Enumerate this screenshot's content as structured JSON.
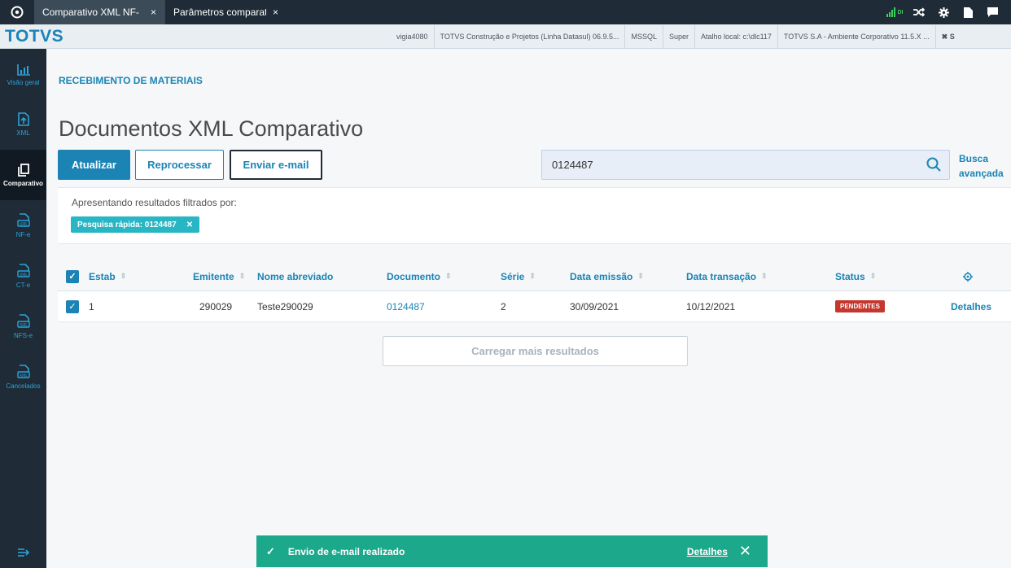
{
  "topbar": {
    "tabs": [
      {
        "title": "Comparativo XML NF-",
        "close": "×"
      },
      {
        "title": "Parâmetros comparati",
        "close": "×"
      }
    ],
    "signal_label": "DI"
  },
  "header": {
    "brand": "TOTVS",
    "info": [
      "vigia4080",
      "TOTVS Construção e Projetos (Linha Datasul) 06.9.5...",
      "MSSQL",
      "Super",
      "Atalho local: c:\\dlc117",
      "TOTVS S.A - Ambiente Corporativo 11.5.X ...",
      "✖ S"
    ]
  },
  "sidebar": {
    "items": [
      {
        "label": "Visão geral",
        "icon": "chart-icon"
      },
      {
        "label": "XML",
        "icon": "upload-file-icon"
      },
      {
        "label": "Comparativo",
        "icon": "copy-icon"
      },
      {
        "label": "NF-e",
        "icon": "xml-file-icon"
      },
      {
        "label": "CT-e",
        "icon": "xml-file-icon"
      },
      {
        "label": "NFS-e",
        "icon": "xml-file-icon"
      },
      {
        "label": "Cancelados",
        "icon": "xml-file-icon"
      }
    ]
  },
  "page": {
    "breadcrumb": "RECEBIMENTO DE MATERIAIS",
    "title": "Documentos XML Comparativo",
    "actions": {
      "refresh": "Atualizar",
      "reprocess": "Reprocessar",
      "send_email": "Enviar e-mail"
    },
    "search": {
      "value": "0124487",
      "advanced": [
        "Busca",
        "avançada"
      ]
    },
    "filter": {
      "label": "Apresentando resultados filtrados por:",
      "chip": "Pesquisa rápida: 0124487"
    }
  },
  "table": {
    "columns": {
      "estab": "Estab",
      "emitente": "Emitente",
      "nome": "Nome abreviado",
      "documento": "Documento",
      "serie": "Série",
      "data_emissao": "Data emissão",
      "data_transacao": "Data transação",
      "status": "Status"
    },
    "rows": [
      {
        "estab": "1",
        "emitente": "290029",
        "nome": "Teste290029",
        "documento": "0124487",
        "serie": "2",
        "data_emissao": "30/09/2021",
        "data_transacao": "10/12/2021",
        "status": "PENDENTES",
        "action": "Detalhes"
      }
    ],
    "load_more": "Carregar mais resultados"
  },
  "toast": {
    "message": "Envio de e-mail realizado",
    "details": "Detalhes",
    "color": "#1ca88a"
  },
  "colors": {
    "primary": "#1b84b5",
    "sidebar": "#1f2b36",
    "badge": "#c5362c"
  }
}
